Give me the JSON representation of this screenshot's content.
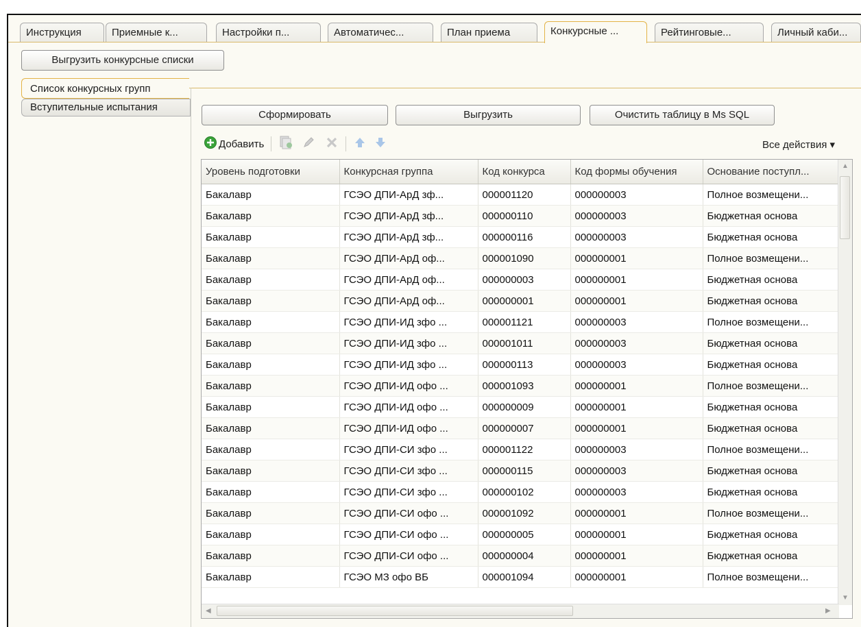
{
  "tabs": [
    {
      "label": "Инструкция"
    },
    {
      "label": "Приемные к..."
    },
    {
      "label": "Настройки п..."
    },
    {
      "label": "Автоматичес..."
    },
    {
      "label": "План приема"
    },
    {
      "label": "Конкурсные ..."
    },
    {
      "label": "Рейтинговые..."
    },
    {
      "label": "Личный каби..."
    }
  ],
  "export_lists_button": "Выгрузить конкурсные списки",
  "side_tabs": {
    "active": "Список конкурсных групп",
    "other": "Вступительные испытания"
  },
  "actions": {
    "form": "Сформировать",
    "export": "Выгрузить",
    "clear": "Очистить таблицу в Ms SQL"
  },
  "toolbar": {
    "add": "Добавить",
    "all_actions": "Все действия"
  },
  "table": {
    "columns": [
      "Уровень подготовки",
      "Конкурсная группа",
      "Код конкурса",
      "Код формы обучения",
      "Основание поступл..."
    ],
    "rows": [
      [
        "Бакалавр",
        "ГСЭО ДПИ-АрД зф...",
        "000001120",
        "000000003",
        "Полное возмещени..."
      ],
      [
        "Бакалавр",
        "ГСЭО ДПИ-АрД зф...",
        "000000110",
        "000000003",
        "Бюджетная основа"
      ],
      [
        "Бакалавр",
        "ГСЭО ДПИ-АрД зф...",
        "000000116",
        "000000003",
        "Бюджетная основа"
      ],
      [
        "Бакалавр",
        "ГСЭО ДПИ-АрД оф...",
        "000001090",
        "000000001",
        "Полное возмещени..."
      ],
      [
        "Бакалавр",
        "ГСЭО ДПИ-АрД оф...",
        "000000003",
        "000000001",
        "Бюджетная основа"
      ],
      [
        "Бакалавр",
        "ГСЭО ДПИ-АрД оф...",
        "000000001",
        "000000001",
        "Бюджетная основа"
      ],
      [
        "Бакалавр",
        "ГСЭО ДПИ-ИД зфо ...",
        "000001121",
        "000000003",
        "Полное возмещени..."
      ],
      [
        "Бакалавр",
        "ГСЭО ДПИ-ИД зфо ...",
        "000001011",
        "000000003",
        "Бюджетная основа"
      ],
      [
        "Бакалавр",
        "ГСЭО ДПИ-ИД зфо ...",
        "000000113",
        "000000003",
        "Бюджетная основа"
      ],
      [
        "Бакалавр",
        "ГСЭО ДПИ-ИД офо ...",
        "000001093",
        "000000001",
        "Полное возмещени..."
      ],
      [
        "Бакалавр",
        "ГСЭО ДПИ-ИД офо ...",
        "000000009",
        "000000001",
        "Бюджетная основа"
      ],
      [
        "Бакалавр",
        "ГСЭО ДПИ-ИД офо ...",
        "000000007",
        "000000001",
        "Бюджетная основа"
      ],
      [
        "Бакалавр",
        "ГСЭО ДПИ-СИ зфо ...",
        "000001122",
        "000000003",
        "Полное возмещени..."
      ],
      [
        "Бакалавр",
        "ГСЭО ДПИ-СИ зфо ...",
        "000000115",
        "000000003",
        "Бюджетная основа"
      ],
      [
        "Бакалавр",
        "ГСЭО ДПИ-СИ зфо ...",
        "000000102",
        "000000003",
        "Бюджетная основа"
      ],
      [
        "Бакалавр",
        "ГСЭО ДПИ-СИ офо ...",
        "000001092",
        "000000001",
        "Полное возмещени..."
      ],
      [
        "Бакалавр",
        "ГСЭО ДПИ-СИ офо ...",
        "000000005",
        "000000001",
        "Бюджетная основа"
      ],
      [
        "Бакалавр",
        "ГСЭО ДПИ-СИ офо ...",
        "000000004",
        "000000001",
        "Бюджетная основа"
      ],
      [
        "Бакалавр",
        "ГСЭО МЗ офо ВБ",
        "000001094",
        "000000001",
        "Полное возмещени..."
      ]
    ]
  },
  "colors": {
    "active_tab_border": "#e3b346",
    "add_icon": "#3aa33a",
    "arrow_icon": "#7aa6d8"
  }
}
